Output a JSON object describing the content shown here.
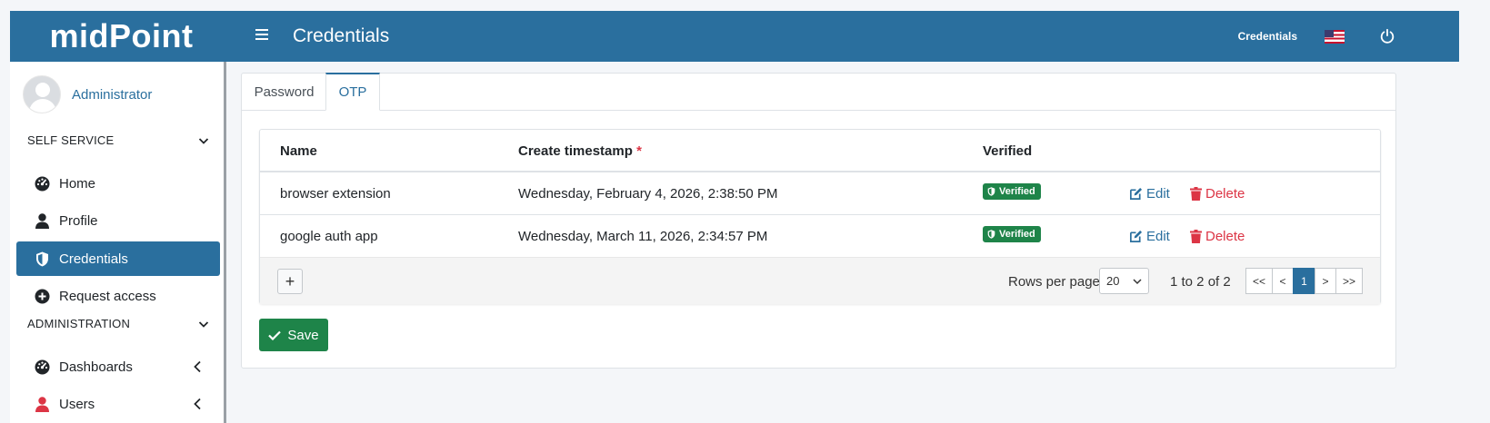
{
  "header": {
    "brand": "midPoint",
    "title": "Credentials",
    "right_link": "Credentials"
  },
  "sidebar": {
    "user_name": "Administrator",
    "sections": [
      {
        "title": "SELF SERVICE",
        "items": [
          {
            "label": "Home",
            "icon": "dashboard-icon"
          },
          {
            "label": "Profile",
            "icon": "user-icon"
          },
          {
            "label": "Credentials",
            "icon": "shield-icon",
            "active": true
          },
          {
            "label": "Request access",
            "icon": "plus-circle-icon"
          }
        ]
      },
      {
        "title": "ADMINISTRATION",
        "items": [
          {
            "label": "Dashboards",
            "icon": "dashboard-icon"
          },
          {
            "label": "Users",
            "icon": "user-icon"
          }
        ]
      }
    ]
  },
  "tabs": [
    {
      "label": "Password",
      "active": false
    },
    {
      "label": "OTP",
      "active": true
    }
  ],
  "table": {
    "columns": {
      "name": "Name",
      "timestamp": "Create timestamp",
      "required_mark": "*",
      "verified": "Verified"
    },
    "rows": [
      {
        "name": "browser extension",
        "timestamp": "Wednesday, February 4, 2026, 2:38:50 PM",
        "verified": "Verified",
        "edit": "Edit",
        "delete": "Delete"
      },
      {
        "name": "google auth app",
        "timestamp": "Wednesday, March 11, 2026, 2:34:57 PM",
        "verified": "Verified",
        "edit": "Edit",
        "delete": "Delete"
      }
    ],
    "footer": {
      "add_symbol": "+",
      "rows_per_page_label": "Rows per page",
      "rows_per_page_value": "20",
      "range": "1 to 2 of 2",
      "pager": [
        "<<",
        "<",
        "1",
        ">",
        ">>"
      ]
    }
  },
  "save_label": "Save",
  "colors": {
    "primary": "#2a6f9e",
    "success": "#1e8449",
    "danger": "#dc3545"
  }
}
